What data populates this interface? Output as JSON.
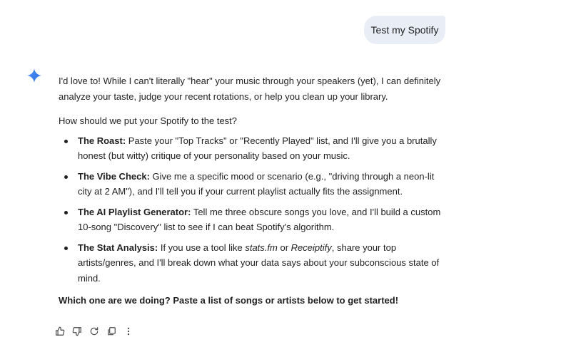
{
  "user_message": {
    "text": "Test my Spotify"
  },
  "response": {
    "intro": "I'd love to! While I can't literally \"hear\" your music through your speakers (yet), I can definitely analyze your taste, judge your recent rotations, or help you clean up your library.",
    "question": "How should we put your Spotify to the test?",
    "options": [
      {
        "title": "The Roast:",
        "text": " Paste your \"Top Tracks\" or \"Recently Played\" list, and I'll give you a brutally honest (but witty) critique of your personality based on your music."
      },
      {
        "title": "The Vibe Check:",
        "text": " Give me a specific mood or scenario (e.g., \"driving through a neon-lit city at 2 AM\"), and I'll tell you if your current playlist actually fits the assignment."
      },
      {
        "title": "The AI Playlist Generator:",
        "text": " Tell me three obscure songs you love, and I'll build a custom 10-song \"Discovery\" list to see if I can beat Spotify's algorithm."
      },
      {
        "title": "The Stat Analysis:",
        "text_before": " If you use a tool like ",
        "em1": "stats.fm",
        "text_mid": " or ",
        "em2": "Receiptify",
        "text_after": ", share your top artists/genres, and I'll break down what your data says about your subconscious state of mind."
      }
    ],
    "closing": "Which one are we doing? Paste a list of songs or artists below to get started!"
  },
  "actions": [
    {
      "icon": "thumbs-up-icon"
    },
    {
      "icon": "thumbs-down-icon"
    },
    {
      "icon": "refresh-icon"
    },
    {
      "icon": "copy-icon"
    },
    {
      "icon": "more-vertical-icon"
    }
  ],
  "colors": {
    "bubble": "#e9eef6",
    "text": "#1f1f1f",
    "icon": "#444746",
    "spark_start": "#4285f4",
    "spark_end": "#1a73e8"
  }
}
